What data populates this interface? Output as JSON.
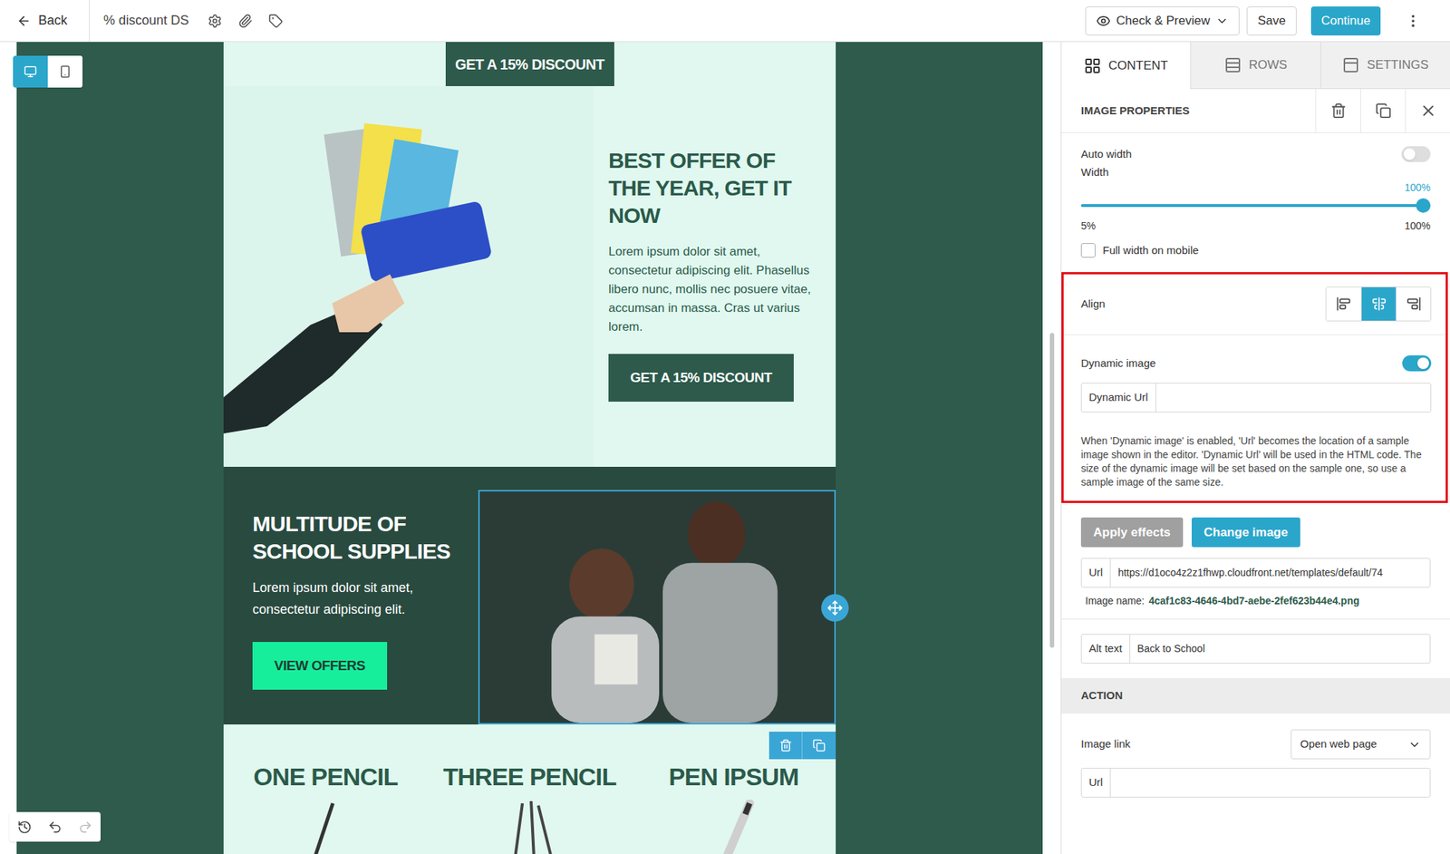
{
  "toolbar": {
    "back": "Back",
    "title": "% discount DS",
    "preview": "Check & Preview",
    "save": "Save",
    "continue": "Continue"
  },
  "view_modes": [
    {
      "kind": "desktop",
      "selected": true
    },
    {
      "kind": "mobile",
      "selected": false
    }
  ],
  "history_buttons": [
    {
      "kind": "history",
      "disabled": false
    },
    {
      "kind": "undo",
      "disabled": false
    },
    {
      "kind": "redo",
      "disabled": true
    }
  ],
  "email": {
    "top_button": "GET A 15% DISCOUNT",
    "hero": {
      "heading": "BEST OFFER OF THE YEAR, GET IT NOW",
      "body": "Lorem ipsum dolor sit amet, consectetur adipiscing elit. Phasellus libero nunc, mollis nec posuere vitae, accumsan in massa. Cras ut varius lorem.",
      "button": "GET A 15% DISCOUNT"
    },
    "feature": {
      "heading": "MULTITUDE OF SCHOOL SUPPLIES",
      "body": "Lorem ipsum dolor sit amet, consectetur adipiscing elit.",
      "button": "VIEW OFFERS",
      "image_selected": true
    },
    "products": [
      {
        "title": "ONE PENCIL",
        "kind": "pencil"
      },
      {
        "title": "THREE PENCIL",
        "kind": "pencils"
      },
      {
        "title": "PEN IPSUM",
        "kind": "pen"
      }
    ]
  },
  "panel": {
    "tabs": [
      {
        "label": "CONTENT",
        "selected": true
      },
      {
        "label": "ROWS",
        "selected": false
      },
      {
        "label": "SETTINGS",
        "selected": false
      }
    ],
    "header": "IMAGE PROPERTIES",
    "auto_width": {
      "label": "Auto width",
      "on": false
    },
    "width": {
      "label": "Width",
      "reading": "100%",
      "level": 1,
      "min": "5%",
      "max": "100%"
    },
    "full_width_mobile": {
      "label": "Full width on mobile",
      "checked": false
    },
    "align": {
      "label": "Align",
      "options": [
        {
          "kind": "left",
          "selected": false
        },
        {
          "kind": "center",
          "selected": true
        },
        {
          "kind": "right",
          "selected": false
        }
      ]
    },
    "dynamic_image": {
      "label": "Dynamic image",
      "on": true,
      "url_label": "Dynamic Url",
      "url_value": "",
      "help": "When 'Dynamic image' is enabled, 'Url' becomes the location of a sample image shown in the editor. 'Dynamic Url' will be used in the HTML code. The size of the dynamic image will be set based on the sample one, so use a sample image of the same size."
    },
    "buttons": [
      {
        "label": "Apply effects",
        "kind": "secondary"
      },
      {
        "label": "Change image",
        "kind": "primary"
      }
    ],
    "url": {
      "label": "Url",
      "value": "https://d1oco4z2z1fhwp.cloudfront.net/templates/default/74"
    },
    "image_name": {
      "label": "Image name:",
      "value": "4caf1c83-4646-4bd7-aebe-2fef623b44e4.png"
    },
    "alt_text": {
      "label": "Alt text",
      "value": "Back to School"
    },
    "action": {
      "header": "ACTION",
      "image_link": {
        "label": "Image link",
        "value": "Open web page"
      },
      "url": {
        "label": "Url",
        "value": ""
      }
    }
  }
}
